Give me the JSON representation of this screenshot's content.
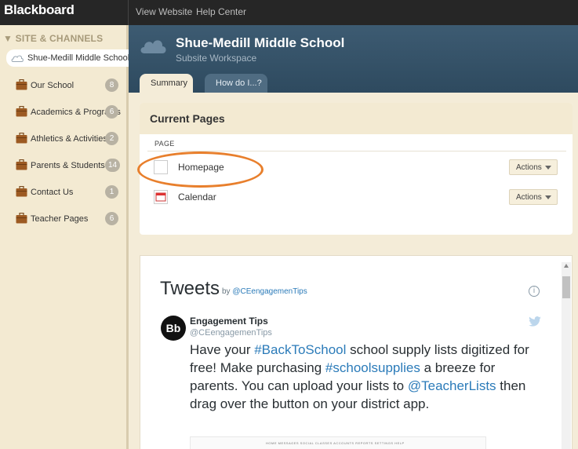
{
  "topbar": {
    "logo": "Blackboard",
    "links": [
      "View Website",
      "Help Center"
    ]
  },
  "sidebar": {
    "heading": "▼ SITE & CHANNELS",
    "site": "Shue-Medill Middle School",
    "items": [
      {
        "label": "Our School",
        "count": "8"
      },
      {
        "label": "Academics & Programs",
        "count": "6"
      },
      {
        "label": "Athletics & Activities",
        "count": "2"
      },
      {
        "label": "Parents & Students",
        "count": "14"
      },
      {
        "label": "Contact Us",
        "count": "1"
      },
      {
        "label": "Teacher Pages",
        "count": "6"
      }
    ]
  },
  "header": {
    "title": "Shue-Medill Middle School",
    "subtitle": "Subsite Workspace",
    "tabs": [
      "Summary",
      "How do I...?"
    ]
  },
  "current_pages": {
    "title": "Current Pages",
    "column": "PAGE",
    "rows": [
      {
        "label": "Homepage",
        "action": "Actions"
      },
      {
        "label": "Calendar",
        "action": "Actions"
      }
    ]
  },
  "tweets": {
    "title": "Tweets",
    "by_prefix": "by",
    "by_handle": "@CEengagemenTips",
    "info": "i",
    "avatar": "Bb",
    "name": "Engagement Tips",
    "handle": "@CEengagemenTips",
    "body": [
      {
        "t": "Have your ",
        "h": false
      },
      {
        "t": "#BackToSchool",
        "h": true
      },
      {
        "t": " school supply lists digitized for free! Make purchasing ",
        "h": false
      },
      {
        "t": "#schoolsupplies",
        "h": true
      },
      {
        "t": " a breeze for parents. You can upload your lists to ",
        "h": false
      },
      {
        "t": "@TeacherLists",
        "h": true
      },
      {
        "t": " then drag over the button on your district app.",
        "h": false
      }
    ],
    "preview_nav": "HOME   MESSAGES   SOCIAL   CLASSES   ACCOUNTS   REPORTS   SETTINGS   HELP"
  },
  "colors": {
    "accent_circle": "#e87f2c",
    "header_bg": "#3d5b72",
    "sidebar_bg": "#f3ead2",
    "link": "#2b7bb9"
  }
}
